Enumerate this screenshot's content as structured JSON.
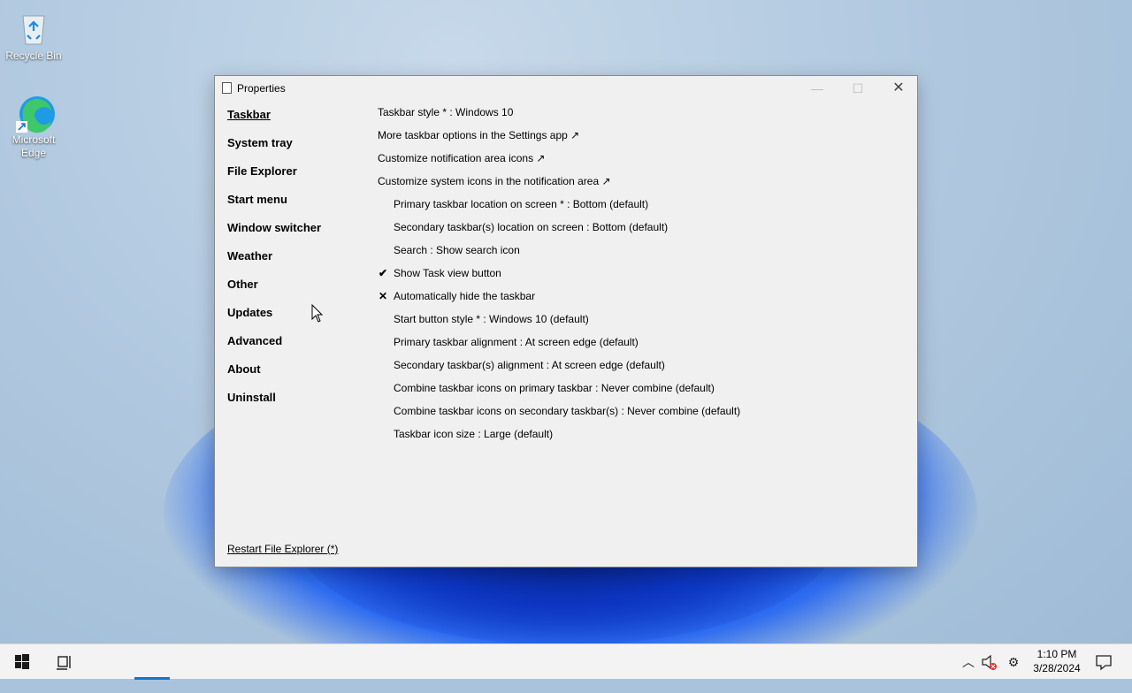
{
  "desktop": {
    "icons": [
      {
        "label": "Recycle Bin",
        "icon": "recycle-bin-icon"
      },
      {
        "label": "Microsoft Edge",
        "icon": "edge-icon"
      }
    ]
  },
  "window": {
    "title": "Properties",
    "nav": [
      {
        "label": "Taskbar",
        "active": true
      },
      {
        "label": "System tray"
      },
      {
        "label": "File Explorer"
      },
      {
        "label": "Start menu"
      },
      {
        "label": "Window switcher"
      },
      {
        "label": "Weather"
      },
      {
        "label": "Other"
      },
      {
        "label": "Updates"
      },
      {
        "label": "Advanced"
      },
      {
        "label": "About"
      },
      {
        "label": "Uninstall"
      }
    ],
    "options": [
      {
        "label": "Taskbar style * : Windows 10"
      },
      {
        "label": "More taskbar options in the Settings app ↗"
      },
      {
        "label": "Customize notification area icons ↗"
      },
      {
        "label": "Customize system icons in the notification area ↗"
      },
      {
        "label": "Primary taskbar location on screen * : Bottom (default)"
      },
      {
        "label": "Secondary taskbar(s) location on screen : Bottom (default)"
      },
      {
        "label": "Search : Show search icon"
      },
      {
        "label": "Show Task view button",
        "mark": "✔"
      },
      {
        "label": "Automatically hide the taskbar",
        "mark": "✕"
      },
      {
        "label": "Start button style * : Windows 10 (default)"
      },
      {
        "label": "Primary taskbar alignment : At screen edge (default)"
      },
      {
        "label": "Secondary taskbar(s) alignment : At screen edge (default)"
      },
      {
        "label": "Combine taskbar icons on primary taskbar : Never combine (default)"
      },
      {
        "label": "Combine taskbar icons on secondary taskbar(s) : Never combine (default)"
      },
      {
        "label": "Taskbar icon size : Large (default)"
      }
    ],
    "restart_link": "Restart File Explorer (*)"
  },
  "taskbar": {
    "time": "1:10 PM",
    "date": "3/28/2024",
    "accent": "#1a73c8"
  }
}
